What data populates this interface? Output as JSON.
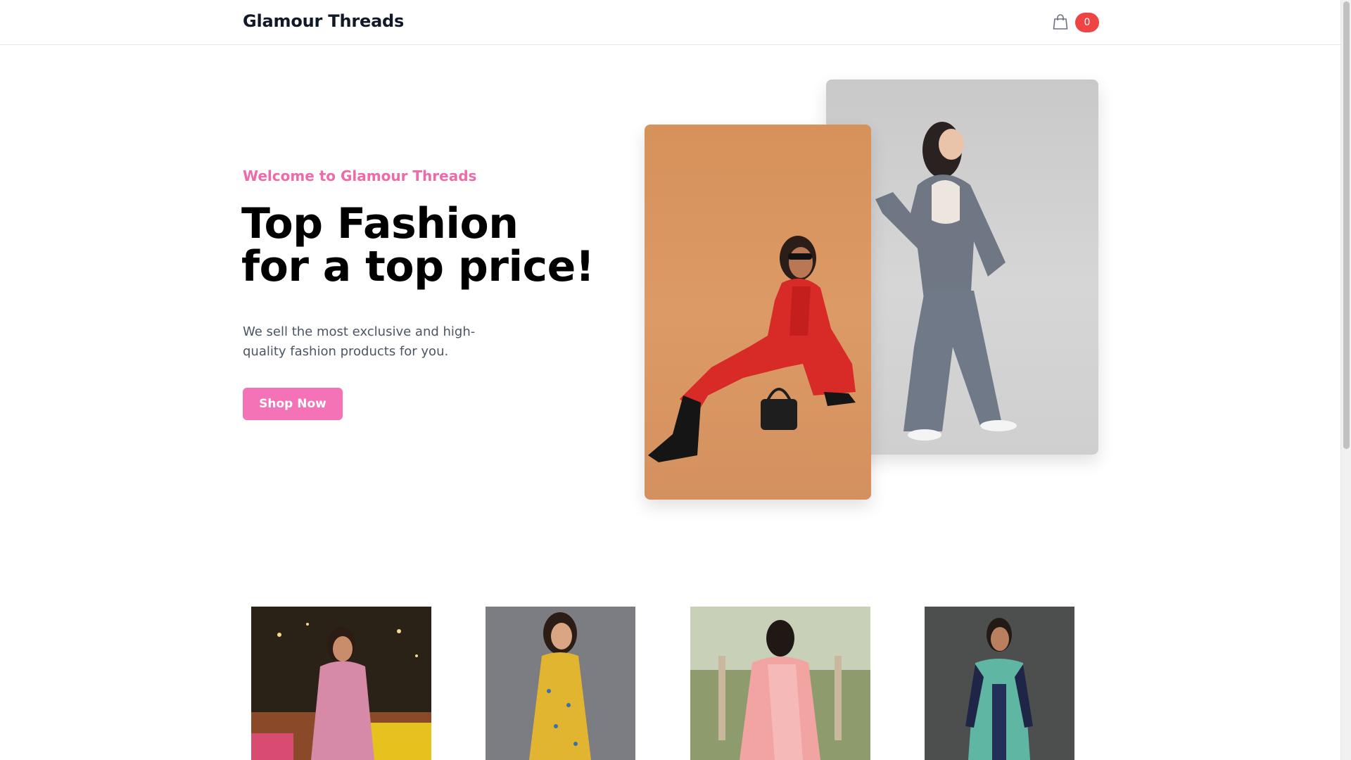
{
  "header": {
    "brand": "Glamour Threads",
    "cart_icon": "shopping-bag-icon",
    "cart_count": "0"
  },
  "hero": {
    "eyebrow": "Welcome to Glamour Threads",
    "headline_line1": "Top Fashion",
    "headline_line2": "for a top price!",
    "subtext": "We sell the most exclusive and high-quality fashion products for you.",
    "cta_label": "Shop Now"
  },
  "colors": {
    "accent": "#f472b6",
    "eyebrow": "#ec6ba8",
    "badge": "#ef4444"
  }
}
